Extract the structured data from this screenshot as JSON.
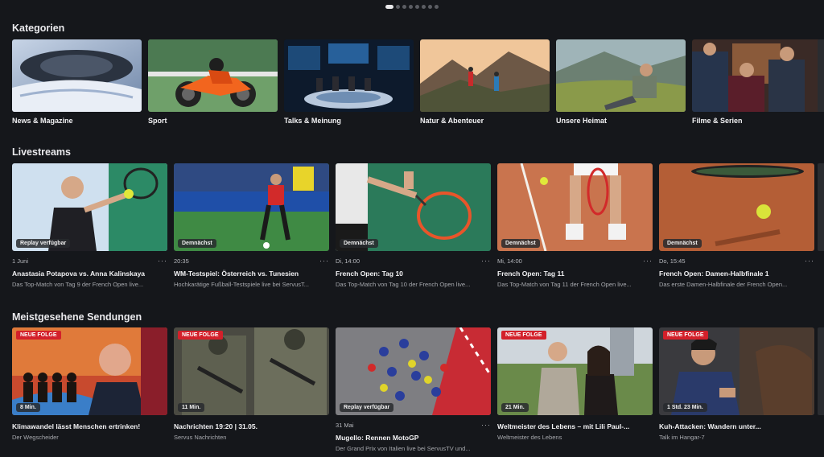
{
  "sections": {
    "kategorien": "Kategorien",
    "livestreams": "Livestreams",
    "meistgesehen": "Meistgesehene Sendungen"
  },
  "categories": [
    {
      "label": "News & Magazine"
    },
    {
      "label": "Sport"
    },
    {
      "label": "Talks & Meinung"
    },
    {
      "label": "Natur & Abenteuer"
    },
    {
      "label": "Unsere Heimat"
    },
    {
      "label": "Filme & Serien"
    }
  ],
  "livestreams": [
    {
      "badge": "Replay verfügbar",
      "time": "1 Juni",
      "title": "Anastasia Potapova vs. Anna Kalinskaya",
      "subtitle": "Das Top-Match von Tag 9 der French Open live..."
    },
    {
      "badge": "Demnächst",
      "time": "20:35",
      "title": "WM-Testspiel: Österreich vs. Tunesien",
      "subtitle": "Hochkarätige Fußball-Testspiele live bei ServusT..."
    },
    {
      "badge": "Demnächst",
      "time": "Di, 14:00",
      "title": "French Open: Tag 10",
      "subtitle": "Das Top-Match von Tag 10 der French Open live..."
    },
    {
      "badge": "Demnächst",
      "time": "Mi, 14:00",
      "title": "French Open: Tag 11",
      "subtitle": "Das Top-Match von Tag 11 der French Open live..."
    },
    {
      "badge": "Demnächst",
      "time": "Do, 15:45",
      "title": "French Open: Damen-Halbfinale 1",
      "subtitle": "Das erste Damen-Halbfinale der French Open..."
    }
  ],
  "most_watched": [
    {
      "new": "NEUE FOLGE",
      "duration": "8 Min.",
      "title": "Klimawandel lässt Menschen ertrinken!",
      "subtitle": "Der Wegscheider"
    },
    {
      "new": "NEUE FOLGE",
      "duration": "11 Min.",
      "title": "Nachrichten 19:20 | 31.05.",
      "subtitle": "Servus Nachrichten"
    },
    {
      "badge": "Replay verfügbar",
      "time": "31 Mai",
      "title": "Mugello: Rennen MotoGP",
      "subtitle": "Der Grand Prix von Italien live bei ServusTV und..."
    },
    {
      "new": "NEUE FOLGE",
      "duration": "21 Min.",
      "title": "Weltmeister des Lebens – mit Lili Paul-...",
      "subtitle": "Weltmeister des Lebens"
    },
    {
      "new": "NEUE FOLGE",
      "duration": "1 Std. 23 Min.",
      "title": "Kuh-Attacken: Wandern unter...",
      "subtitle": "Talk im Hangar-7"
    }
  ],
  "more_glyph": "···"
}
